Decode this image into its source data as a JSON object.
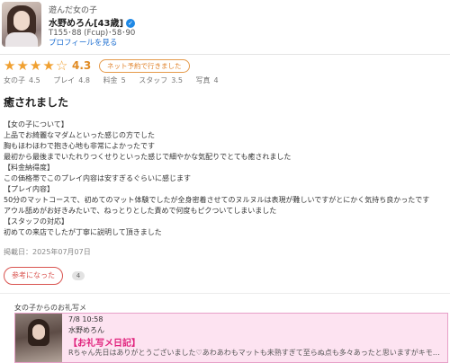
{
  "profile": {
    "visited_label": "遊んだ女の子",
    "name": "水野めろん[43歳]",
    "verified_icon": "verified-check-icon",
    "specs": "T155･88 (Fcup)･58･90",
    "profile_link": "プロフィールを見る"
  },
  "rating": {
    "stars": 4,
    "max_stars": 5,
    "score_text": "4.3",
    "net_badge": "ネット予約で行きました",
    "scores": [
      {
        "label": "女の子",
        "value": "4.5"
      },
      {
        "label": "プレイ",
        "value": "4.8"
      },
      {
        "label": "料金",
        "value": "5"
      },
      {
        "label": "スタッフ",
        "value": "3.5"
      },
      {
        "label": "写真",
        "value": "4"
      }
    ]
  },
  "review": {
    "title": "癒されました",
    "lines": [
      "【女の子について】",
      "上品でお綺麗なマダムといった感じの方でした",
      "胸もほわほわで抱き心地も非常によかったです",
      "最初から最後までいたれりつくせりといった感じで細やかな気配りでとても癒されました",
      "【料金納得度】",
      "この価格帯でこのプレイ内容は安すぎるぐらいに感じます",
      "【プレイ内容】",
      "50分のマットコースで、初めてのマット体験でしたが全身密着させてのヌルヌルは表現が難しいですがとにかく気持ち良かったです",
      "アウル舐めがお好きみたいで、ねっとりとした責めで何度もピクついてしまいました",
      "【スタッフの対応】",
      "初めての来店でしたが丁寧に説明して頂きました"
    ],
    "posted_date": "掲載日：2025年07月07日",
    "helpful_button": "参考になった",
    "helpful_count": "4"
  },
  "thanks": {
    "section_label": "女の子からのお礼写メ",
    "date": "7/8 10:58",
    "name": "水野めろん",
    "title": "【お礼写メ日記】",
    "message": "Rちゃん先日はありがとうございました♡あわあわもマットも未熟すぎて至らぬ点も多々あったと思いますがキモチの面をすく…"
  },
  "colors": {
    "star": "#f0a030",
    "accent_orange": "#e0822a",
    "helpful_red": "#d9534f",
    "thanks_pink": "#fde3f1",
    "thanks_title": "#e0237d",
    "link_blue": "#1e6fd1"
  }
}
